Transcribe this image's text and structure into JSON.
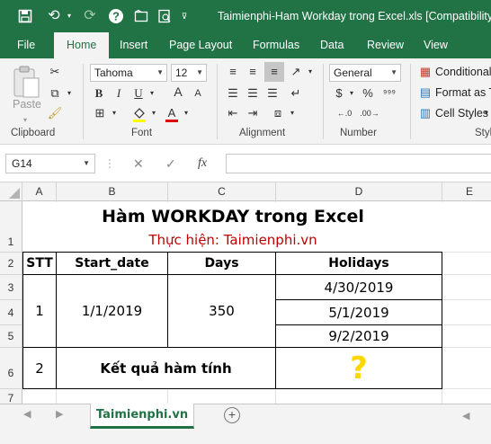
{
  "window": {
    "title": "Taimienphi-Ham Workday trong Excel.xls  [Compatibility"
  },
  "ribbon": {
    "tabs": [
      "File",
      "Home",
      "Insert",
      "Page Layout",
      "Formulas",
      "Data",
      "Review",
      "View"
    ],
    "active_tab": "Home",
    "clipboard": {
      "paste_label": "Paste",
      "group_label": "Clipboard"
    },
    "font": {
      "font_name": "Tahoma",
      "font_size": "12",
      "bold": "B",
      "italic": "I",
      "underline": "U",
      "grow": "A",
      "shrink": "A",
      "group_label": "Font"
    },
    "alignment": {
      "group_label": "Alignment"
    },
    "number": {
      "format": "General",
      "currency": "$",
      "percent": "%",
      "group_label": "Number"
    },
    "styles": {
      "conditional": "Conditional",
      "format_as": "Format as T",
      "cell_styles": "Cell Styles",
      "group_label": "Styl"
    }
  },
  "formula_bar": {
    "name_box": "G14",
    "fx": "fx",
    "cancel": "✕",
    "enter": "✓",
    "value": ""
  },
  "grid": {
    "columns": [
      "A",
      "B",
      "C",
      "D",
      "E"
    ],
    "rows": [
      "1",
      "2",
      "3",
      "4",
      "5",
      "6",
      "7"
    ],
    "title": "Hàm WORKDAY trong Excel",
    "subtitle": "Thực hiện: Taimienphi.vn",
    "headers": {
      "stt": "STT",
      "start_date": "Start_date",
      "days": "Days",
      "holidays": "Holidays"
    },
    "row": {
      "stt": "1",
      "start_date": "1/1/2019",
      "days": "350",
      "holidays": [
        "4/30/2019",
        "5/1/2019",
        "9/2/2019"
      ]
    },
    "result_row": {
      "stt": "2",
      "label": "Kết quả hàm tính",
      "value": "?"
    }
  },
  "sheets": {
    "active": "Taimienphi.vn",
    "add": "+"
  },
  "colors": {
    "excel_green": "#217346",
    "subtitle_red": "#c00000",
    "question_yellow": "#ffd700"
  }
}
